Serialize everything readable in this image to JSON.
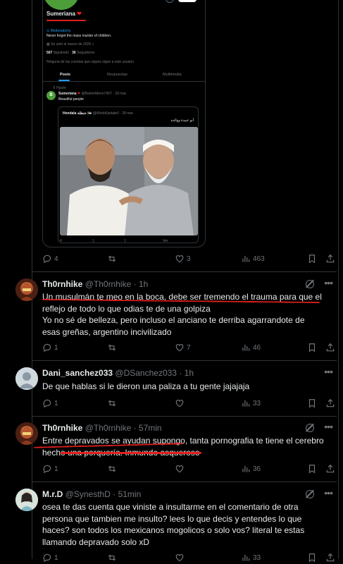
{
  "embedded_profile": {
    "name": "Sumeriana",
    "role_tag": "Moderador/a",
    "bio": "Never forget the mass murder of children.",
    "joined": "Se unió el marzo de 2026",
    "following_count": "567",
    "following_label": "Siguiendo",
    "followers_count": "36",
    "followers_label": "Seguidores",
    "followed_by": "Ninguna de las cuentas que sigues sigue a este usuario",
    "tabs": [
      "Posts",
      "Respuestas",
      "Multimedia"
    ],
    "pinned_label": "Fijado",
    "post_author": "Sumeriana",
    "post_handle": "@BarlonMeno745T · 29 mar.",
    "post_avatar_letter": "B",
    "post_text": "Beautiful people",
    "quote_author": "Hendala حنظلة",
    "quote_handle": "@WorldUpdate0 · 28 mar.",
    "quote_text": "أبو عبيدة ووالده",
    "quote_stats": [
      "4",
      "1",
      "1",
      "Ver"
    ]
  },
  "main_post_actions": {
    "replies": "4",
    "reposts": "",
    "likes": "3",
    "views": "463"
  },
  "replies": [
    {
      "name": "Th0rnhike",
      "handle": "@Th0rnhike",
      "time": "1h",
      "text": "Un musulmán te meo en la boca, debe ser tremendo el trauma para que el reflejo de todo lo que odias te de una golpiza\nYo no sé de belleza, pero incluso el anciano te derriba agarrandote de esas greñas, argentino incivilizado",
      "replies": "1",
      "reposts": "",
      "likes": "7",
      "views": "46"
    },
    {
      "name": "Dani_sanchez033",
      "handle": "@DSanchez033",
      "time": "1h",
      "text": "De que hablas si le dieron una paliza a tu gente jajajaja",
      "replies": "1",
      "reposts": "",
      "likes": "",
      "views": "33"
    },
    {
      "name": "Th0rnhike",
      "handle": "@Th0rnhike",
      "time": "57min",
      "text": "Entre depravados se ayudan supongo, tanta pornografia te tiene el cerebro hecho una porquería. Inmundo asqueroso",
      "replies": "1",
      "reposts": "",
      "likes": "",
      "views": "36"
    },
    {
      "name": "M.r.D",
      "handle": "@SynesthD",
      "time": "51min",
      "text": "osea te das cuenta que viniste a insultarme en el comentario de otra persona que tambien me insulto? lees lo que decis y entendes lo que haces? son todos los mexicanos mogolicos o solo vos? literal te estas llamando depravado solo xD",
      "replies": "1",
      "reposts": "",
      "likes": "",
      "views": "33"
    }
  ],
  "colors": {
    "background": "#000000",
    "text": "#e7e9ea",
    "muted": "#71767b",
    "border": "#2f3336",
    "accent": "#1d9bf0",
    "annotation": "#e0201d"
  },
  "icons": [
    "reply-icon",
    "repost-icon",
    "like-icon",
    "views-icon",
    "bookmark-icon",
    "share-icon",
    "grok-icon",
    "more-icon"
  ]
}
